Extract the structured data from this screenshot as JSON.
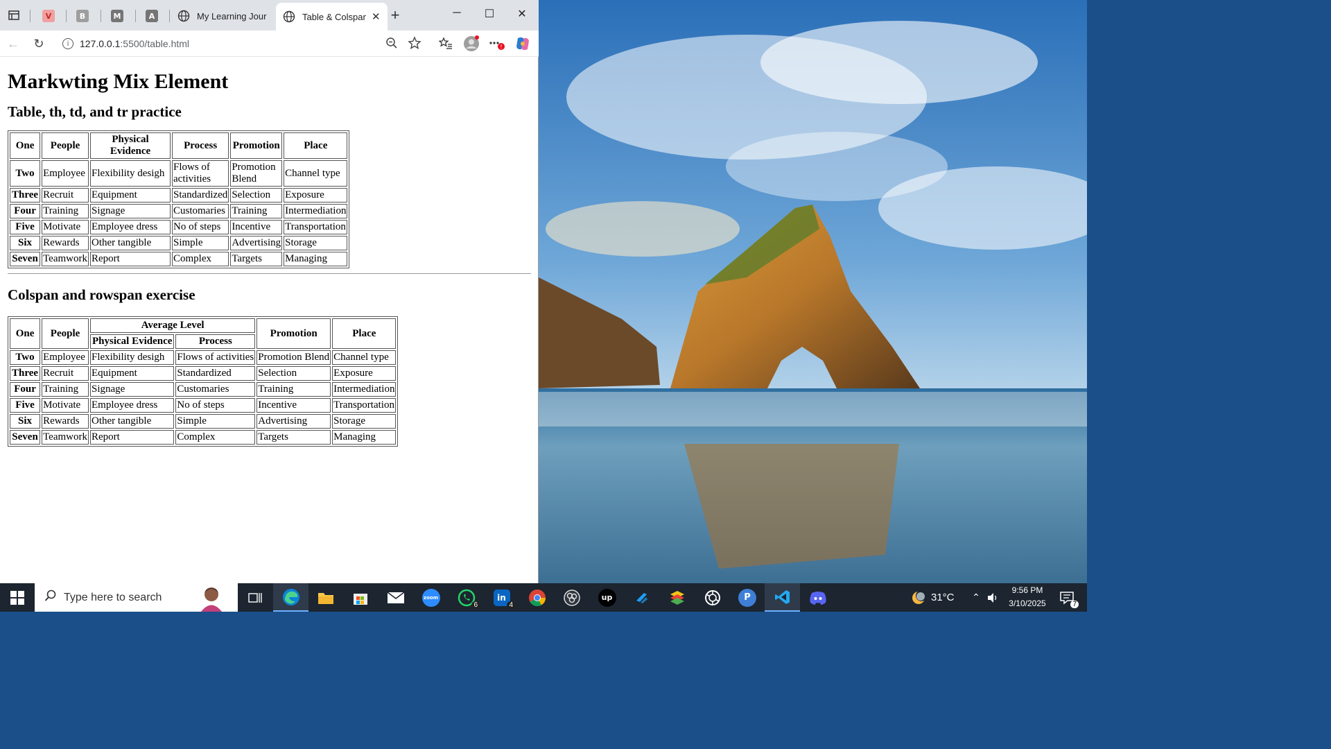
{
  "browser": {
    "tabs": [
      {
        "title": "My Learning Jour",
        "active": false
      },
      {
        "title": "Table & Colspan",
        "active": true
      }
    ],
    "pinned_tabs": [
      {
        "icon": "vivaldi-icon",
        "color": "#e57373",
        "letter": "V"
      },
      {
        "icon": "b-app-icon",
        "color": "#9e9e9e",
        "letter": "B"
      },
      {
        "icon": "m-app-icon",
        "color": "#757575",
        "letter": "M"
      },
      {
        "icon": "a-app-icon",
        "color": "#757575",
        "letter": "A"
      }
    ],
    "url_host": "127.0.0.1",
    "url_path": ":5500/table.html",
    "new_tab_label": "+"
  },
  "page": {
    "title": "Markwting Mix Element",
    "section1_title": "Table, th, td, and tr practice",
    "section2_title": "Colspan and rowspan exercise",
    "table1": {
      "headers": [
        "One",
        "People",
        "Physical Evidence",
        "Process",
        "Promotion",
        "Place"
      ],
      "rows": [
        {
          "head": "Two",
          "cells": [
            "Employee",
            "Flexibility desigh",
            "Flows of activities",
            "Promotion Blend",
            "Channel type"
          ]
        },
        {
          "head": "Three",
          "cells": [
            "Recruit",
            "Equipment",
            "Standardized",
            "Selection",
            "Exposure"
          ]
        },
        {
          "head": "Four",
          "cells": [
            "Training",
            "Signage",
            "Customaries",
            "Training",
            "Intermediation"
          ]
        },
        {
          "head": "Five",
          "cells": [
            "Motivate",
            "Employee dress",
            "No of steps",
            "Incentive",
            "Transportation"
          ]
        },
        {
          "head": "Six",
          "cells": [
            "Rewards",
            "Other tangible",
            "Simple",
            "Advertising",
            "Storage"
          ]
        },
        {
          "head": "Seven",
          "cells": [
            "Teamwork",
            "Report",
            "Complex",
            "Targets",
            "Managing"
          ]
        }
      ]
    },
    "table2": {
      "h_one": "One",
      "h_people": "People",
      "h_average": "Average Level",
      "h_physical": "Physical Evidence",
      "h_process": "Process",
      "h_promotion": "Promotion",
      "h_place": "Place",
      "rows": [
        {
          "head": "Two",
          "cells": [
            "Employee",
            "Flexibility desigh",
            "Flows of activities",
            "Promotion Blend",
            "Channel type"
          ]
        },
        {
          "head": "Three",
          "cells": [
            "Recruit",
            "Equipment",
            "Standardized",
            "Selection",
            "Exposure"
          ]
        },
        {
          "head": "Four",
          "cells": [
            "Training",
            "Signage",
            "Customaries",
            "Training",
            "Intermediation"
          ]
        },
        {
          "head": "Five",
          "cells": [
            "Motivate",
            "Employee dress",
            "No of steps",
            "Incentive",
            "Transportation"
          ]
        },
        {
          "head": "Six",
          "cells": [
            "Rewards",
            "Other tangible",
            "Simple",
            "Advertising",
            "Storage"
          ]
        },
        {
          "head": "Seven",
          "cells": [
            "Teamwork",
            "Report",
            "Complex",
            "Targets",
            "Managing"
          ]
        }
      ]
    }
  },
  "taskbar": {
    "search_placeholder": "Type here to search",
    "weather_temp": "31°C",
    "time": "9:56 PM",
    "date": "3/10/2025",
    "notification_count": "7",
    "whatsapp_badge": "6",
    "linkedin_badge": "4",
    "apps": [
      "task-view-icon",
      "edge-icon",
      "file-explorer-icon",
      "store-icon",
      "mail-icon",
      "zoom-icon",
      "whatsapp-icon",
      "linkedin-icon",
      "chrome-icon",
      "obs-icon",
      "upwork-icon",
      "vscode-alt-icon",
      "bluestacks-icon",
      "chatgpt-icon",
      "p-app-icon",
      "vscode-icon",
      "discord-icon"
    ]
  },
  "colors": {
    "taskbar_bg": "#1c2530",
    "tabbar_bg": "#dfe3e8",
    "edge_blue": "#0a84d6",
    "accent_red": "#e81123"
  }
}
